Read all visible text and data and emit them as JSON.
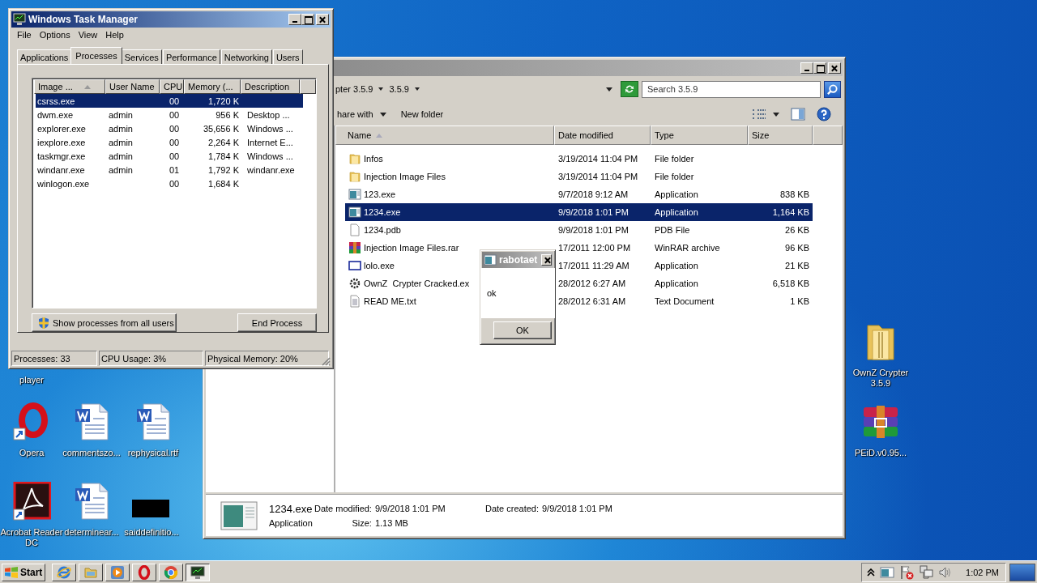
{
  "task_manager": {
    "title": "Windows Task Manager",
    "menu": [
      "File",
      "Options",
      "View",
      "Help"
    ],
    "tabs": [
      {
        "label": "Applications",
        "selected": false
      },
      {
        "label": "Processes",
        "selected": true
      },
      {
        "label": "Services",
        "selected": false
      },
      {
        "label": "Performance",
        "selected": false
      },
      {
        "label": "Networking",
        "selected": false
      },
      {
        "label": "Users",
        "selected": false
      }
    ],
    "columns": [
      "Image ...",
      "User Name",
      "CPU",
      "Memory (...",
      "Description"
    ],
    "rows": [
      {
        "image": "csrss.exe",
        "cpu": "00",
        "memory": "1,720 K",
        "selected": true
      },
      {
        "image": "dwm.exe",
        "user": "admin",
        "cpu": "00",
        "memory": "956 K",
        "description": "Desktop ...",
        "selected": false
      },
      {
        "image": "explorer.exe",
        "user": "admin",
        "cpu": "00",
        "memory": "35,656 K",
        "description": "Windows ...",
        "selected": false
      },
      {
        "image": "iexplore.exe",
        "user": "admin",
        "cpu": "00",
        "memory": "2,264 K",
        "description": "Internet E...",
        "selected": false
      },
      {
        "image": "taskmgr.exe",
        "user": "admin",
        "cpu": "00",
        "memory": "1,784 K",
        "description": "Windows ...",
        "selected": false
      },
      {
        "image": "windanr.exe",
        "user": "admin",
        "cpu": "01",
        "memory": "1,792 K",
        "description": "windanr.exe",
        "selected": false
      },
      {
        "image": "winlogon.exe",
        "cpu": "00",
        "memory": "1,684 K",
        "selected": false
      }
    ],
    "show_all_button": "Show processes from all users",
    "end_button": "End Process",
    "status": [
      "Processes: 33",
      "CPU Usage: 3%",
      "Physical Memory: 20%"
    ]
  },
  "explorer": {
    "breadcrumbs": [
      "pter 3.5.9",
      "3.5.9"
    ],
    "search_placeholder": "Search 3.5.9",
    "toolbar": [
      "hare with",
      "New folder"
    ],
    "columns": [
      "Name",
      "Date modified",
      "Type",
      "Size"
    ],
    "files": [
      {
        "kind": "folder",
        "name": "Infos",
        "date": "3/19/2014 11:04 PM",
        "type": "File folder",
        "selected": false
      },
      {
        "kind": "folder",
        "name": "Injection Image Files",
        "date": "3/19/2014 11:04 PM",
        "type": "File folder",
        "selected": false
      },
      {
        "kind": "exe",
        "name": "123.exe",
        "date": "9/7/2018 9:12 AM",
        "type": "Application",
        "size": "838 KB",
        "selected": false
      },
      {
        "kind": "exe",
        "name": "1234.exe",
        "date": "9/9/2018 1:01 PM",
        "type": "Application",
        "size": "1,164 KB",
        "selected": true
      },
      {
        "kind": "file",
        "name": "1234.pdb",
        "date": "9/9/2018 1:01 PM",
        "type": "PDB File",
        "size": "26 KB",
        "selected": false
      },
      {
        "kind": "archive",
        "name": "Injection Image Files.rar",
        "date": "17/2011 12:00 PM",
        "type": "WinRAR archive",
        "size": "96 KB",
        "selected": false
      },
      {
        "kind": "window",
        "name": "lolo.exe",
        "date": "17/2011 11:29 AM",
        "type": "Application",
        "size": "21 KB",
        "selected": false
      },
      {
        "kind": "gear",
        "name": "OwnZ  Crypter Cracked.ex",
        "date": "28/2012 6:27 AM",
        "type": "Application",
        "size": "6,518 KB",
        "selected": false
      },
      {
        "kind": "text",
        "name": "READ ME.txt",
        "date": "28/2012 6:31 AM",
        "type": "Text Document",
        "size": "1 KB",
        "selected": false
      }
    ],
    "details": {
      "name": "1234.exe",
      "type": "Application",
      "fields": [
        {
          "label": "Date modified:",
          "value": "9/9/2018 1:01 PM"
        },
        {
          "label": "Date created:",
          "value": "9/9/2018 1:01 PM"
        },
        {
          "label": "Size:",
          "value": "1.13 MB"
        }
      ]
    }
  },
  "dialog": {
    "title": "rabotaet",
    "message": "ok",
    "button": "OK"
  },
  "desktop_icons": [
    {
      "kind": "label",
      "label": "player"
    },
    {
      "kind": "opera",
      "label": "Opera"
    },
    {
      "kind": "document",
      "label": "commentszo..."
    },
    {
      "kind": "document",
      "label": "rephysical.rtf"
    },
    {
      "kind": "pdf",
      "label": "Acrobat Reader DC"
    },
    {
      "kind": "document",
      "label": "determinear..."
    },
    {
      "kind": "blank",
      "label": "saiddefinitio..."
    },
    {
      "kind": "folder",
      "label": "OwnZ Crypter 3.5.9"
    },
    {
      "kind": "archive",
      "label": "PEiD.v0.95..."
    }
  ],
  "taskbar": {
    "start": "Start",
    "apps": [
      {
        "kind": "ie",
        "active": false
      },
      {
        "kind": "folder",
        "active": false
      },
      {
        "kind": "media",
        "active": false
      },
      {
        "kind": "opera",
        "active": false
      },
      {
        "kind": "chrome",
        "active": false
      },
      {
        "kind": "taskmgr",
        "active": true
      }
    ],
    "clock": "1:02 PM"
  }
}
